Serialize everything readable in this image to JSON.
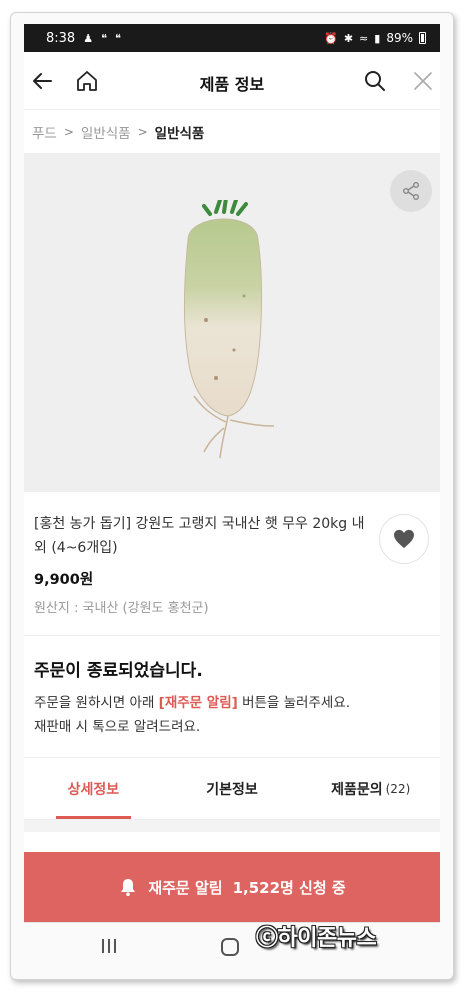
{
  "status_bar": {
    "time": "8:38",
    "left_icons": [
      "person-icon",
      "notification-icon",
      "notification-icon"
    ],
    "battery": "89%"
  },
  "nav": {
    "title": "제품 정보"
  },
  "breadcrumb": [
    "푸드",
    "일반식품",
    "일반식품"
  ],
  "product": {
    "name": "[홍천 농가 돕기] 강원도 고랭지 국내산 햇 무우 20kg 내외 (4~6개입)",
    "price": "9,900원",
    "origin": "원산지 : 국내산 (강원도 홍천군)"
  },
  "notice": {
    "title": "주문이 종료되었습니다.",
    "line1_before": "주문을 원하시면 아래 ",
    "line1_highlight": "[재주문 알림]",
    "line1_after": " 버튼을 눌러주세요.",
    "line2": "재판매 시 톡으로 알려드려요."
  },
  "tabs": [
    {
      "label": "상세정보",
      "active": true
    },
    {
      "label": "기본정보",
      "active": false
    },
    {
      "label": "제품문의",
      "count": "(22)",
      "active": false
    }
  ],
  "restock": {
    "label": "재주문 알림",
    "count_text": "1,522명 신청 중"
  },
  "watermark": "ⓒ하이존뉴스",
  "colors": {
    "accent": "#dd5b55",
    "restock_bg": "#dd6460",
    "status_bar": "#1a1a1a"
  }
}
